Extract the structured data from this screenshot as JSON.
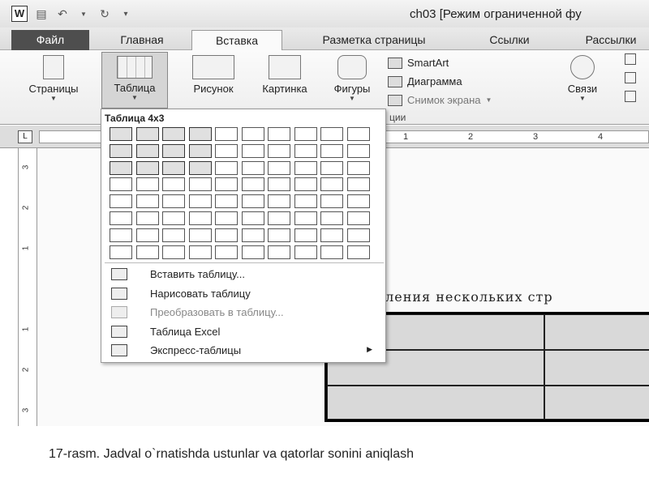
{
  "window": {
    "title": "ch03 [Режим ограниченной фу"
  },
  "quick_access": {
    "app_icon": "W"
  },
  "tabs": [
    {
      "label": "Файл"
    },
    {
      "label": "Главная"
    },
    {
      "label": "Вставка"
    },
    {
      "label": "Разметка страницы"
    },
    {
      "label": "Ссылки"
    },
    {
      "label": "Рассылки"
    }
  ],
  "ribbon": {
    "pages": {
      "label": "Страницы"
    },
    "table": {
      "label": "Таблица"
    },
    "picture": {
      "label": "Рисунок"
    },
    "clipart": {
      "label": "Картинка"
    },
    "shapes": {
      "label": "Фигуры"
    },
    "smartart": {
      "label": "SmartArt"
    },
    "chart": {
      "label": "Диаграмма"
    },
    "screenshot": {
      "label": "Снимок экрана"
    },
    "links": {
      "label": "Связи"
    },
    "group_illustrations": "ции"
  },
  "ruler": {
    "numbers": [
      "1",
      "2",
      "3",
      "4"
    ],
    "left_numbers": [
      "3",
      "2",
      "1",
      "1",
      "2",
      "3"
    ]
  },
  "table_menu": {
    "title": "Таблица 4x3",
    "grid_cols": 10,
    "grid_rows": 8,
    "highlight_cols": 4,
    "highlight_rows": 3,
    "items": [
      {
        "label": "Вставить таблицу...",
        "enabled": true
      },
      {
        "label": "Нарисовать таблицу",
        "enabled": true
      },
      {
        "label": "Преобразовать в таблицу...",
        "enabled": false
      },
      {
        "label": "Таблица Excel",
        "enabled": true
      },
      {
        "label": "Экспресс-таблицы",
        "enabled": true,
        "submenu": true
      }
    ]
  },
  "document": {
    "heading": "выделения нескольких стр"
  },
  "caption": "17-rasm. Jadval o`rnatishda ustunlar va qatorlar sonini aniqlash",
  "colors": {
    "file_tab": "#4e4e4e",
    "cell_shade": "#d9d9d9"
  }
}
